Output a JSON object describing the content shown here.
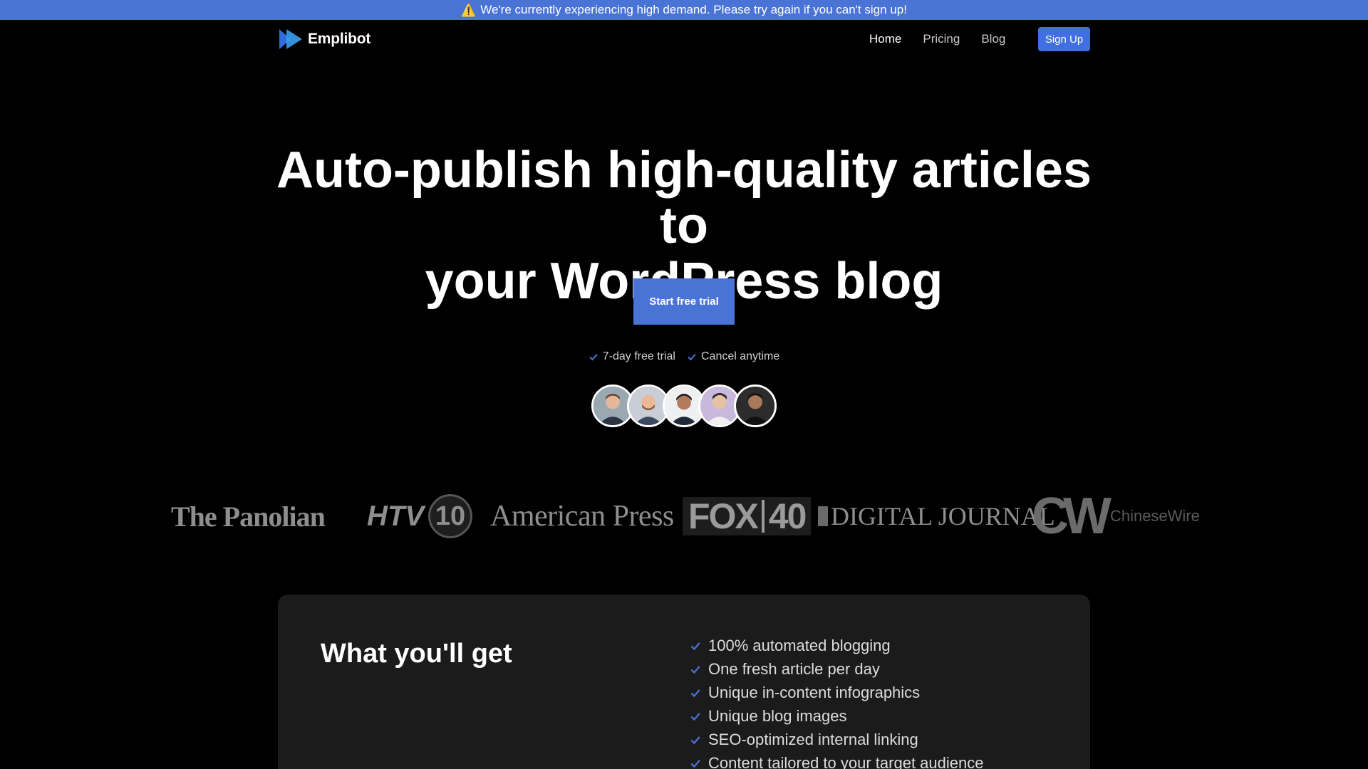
{
  "banner": {
    "icon": "warning-icon",
    "text": "We're currently experiencing high demand. Please try again if you can't sign up!"
  },
  "nav": {
    "logo_text": "Emplibot",
    "links": [
      {
        "label": "Home",
        "active": true
      },
      {
        "label": "Pricing",
        "active": false
      },
      {
        "label": "Blog",
        "active": false
      }
    ],
    "signup_label": "Sign Up"
  },
  "hero": {
    "title_line1": "Auto-publish high-quality articles to",
    "title_line2": "your WordPress blog",
    "cta_label": "Start free trial",
    "perks": [
      "7-day free trial",
      "Cancel anytime"
    ]
  },
  "press_logos": [
    "The Panolian",
    "HTV 10",
    "American Press",
    "FOX 40",
    "Digital Journal",
    "ChineseWire"
  ],
  "press_text": {
    "panolian": "The Panolian",
    "htv": "HTV",
    "htv_num": "10",
    "american": "American Press",
    "fox": "FOX",
    "fox_num": "40",
    "digital": "DIGITAL JOURNAL",
    "cw_mark": "CW",
    "cw_name": "ChineseWire"
  },
  "features_card": {
    "title": "What you'll get",
    "items": [
      "100% automated blogging",
      "One fresh article per day",
      "Unique in-content infographics",
      "Unique blog images",
      "SEO-optimized internal linking",
      "Content tailored to your target audience"
    ]
  },
  "colors": {
    "accent": "#4a73d6",
    "background": "#000000",
    "card": "#1b1b1b"
  }
}
